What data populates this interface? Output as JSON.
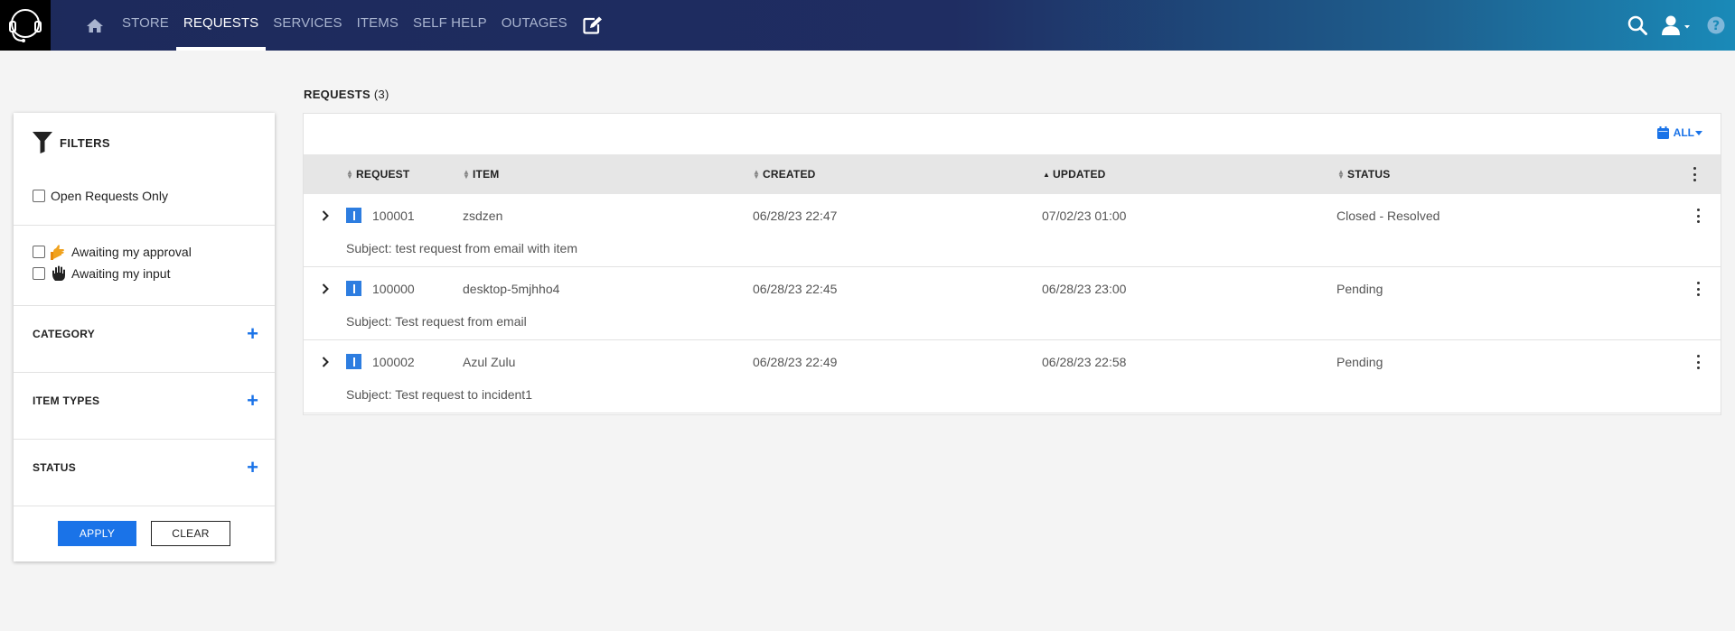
{
  "nav": {
    "items": [
      {
        "label": "STORE",
        "active": false
      },
      {
        "label": "REQUESTS",
        "active": true
      },
      {
        "label": "SERVICES",
        "active": false
      },
      {
        "label": "ITEMS",
        "active": false
      },
      {
        "label": "SELF HELP",
        "active": false
      },
      {
        "label": "OUTAGES",
        "active": false
      }
    ],
    "icons": [
      "headset-logo-icon",
      "home-icon",
      "edit-icon",
      "search-icon",
      "user-icon",
      "help-icon"
    ]
  },
  "filters": {
    "title": "FILTERS",
    "open_only": "Open Requests Only",
    "awaiting_approval": "Awaiting my approval",
    "awaiting_input": "Awaiting my input",
    "sections": [
      "CATEGORY",
      "ITEM TYPES",
      "STATUS"
    ],
    "apply": "APPLY",
    "clear": "CLEAR"
  },
  "requests": {
    "title": "REQUESTS",
    "count": "(3)",
    "all_label": "ALL",
    "columns": [
      "REQUEST",
      "ITEM",
      "CREATED",
      "UPDATED",
      "STATUS"
    ],
    "rows": [
      {
        "request": "100001",
        "item": "zsdzen",
        "created": "06/28/23 22:47",
        "updated": "07/02/23 01:00",
        "status": "Closed - Resolved",
        "subject": "Subject: test request from email with item"
      },
      {
        "request": "100000",
        "item": "desktop-5mjhho4",
        "created": "06/28/23 22:45",
        "updated": "06/28/23 23:00",
        "status": "Pending",
        "subject": "Subject: Test request from email"
      },
      {
        "request": "100002",
        "item": "Azul Zulu",
        "created": "06/28/23 22:49",
        "updated": "06/28/23 22:58",
        "status": "Pending",
        "subject": "Subject: Test request to incident1"
      }
    ]
  },
  "colors": {
    "accent": "#1a73e8",
    "nav_start": "#1d2a5b",
    "nav_end": "#1a8ab8"
  }
}
